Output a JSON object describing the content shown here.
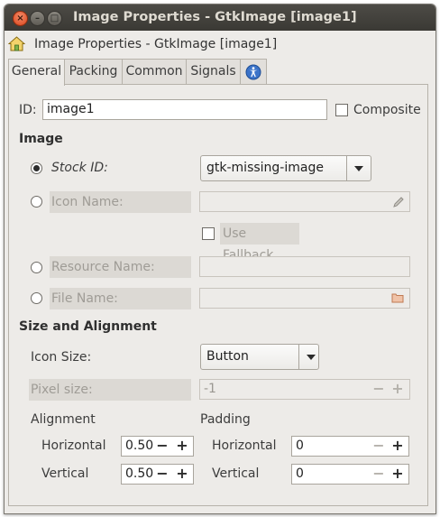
{
  "window": {
    "title": "Image Properties - GtkImage [image1]",
    "buttons": {
      "close": "×",
      "minimize": "–",
      "maximize": "□"
    }
  },
  "header": {
    "icon": "home-icon",
    "title": "Image Properties - GtkImage [image1]"
  },
  "tabs": [
    {
      "label": "General",
      "active": true
    },
    {
      "label": "Packing"
    },
    {
      "label": "Common"
    },
    {
      "label": "Signals"
    },
    {
      "label": "",
      "icon": "accessibility-icon"
    }
  ],
  "general": {
    "id_label": "ID:",
    "id_value": "image1",
    "composite_label": "Composite",
    "image_section": "Image",
    "stock_id_label": "Stock ID:",
    "stock_id_value": "gtk-missing-image",
    "icon_name_label": "Icon Name:",
    "icon_name_value": "",
    "use_fallback_label": "Use Fallback",
    "resource_name_label": "Resource Name:",
    "resource_name_value": "",
    "file_name_label": "File Name:",
    "file_name_value": "",
    "size_section": "Size and Alignment",
    "icon_size_label": "Icon Size:",
    "icon_size_value": "Button",
    "pixel_size_label": "Pixel size:",
    "pixel_size_value": "-1",
    "alignment_label": "Alignment",
    "padding_label": "Padding",
    "horizontal_label": "Horizontal",
    "vertical_label": "Vertical",
    "align_h_value": "0.50",
    "align_v_value": "0.50",
    "pad_h_value": "0",
    "pad_v_value": "0",
    "minus": "−",
    "plus": "+"
  },
  "colors": {
    "window_bg": "#edebe8",
    "titlebar": "#3c3b37",
    "close_button": "#e05b2f"
  }
}
